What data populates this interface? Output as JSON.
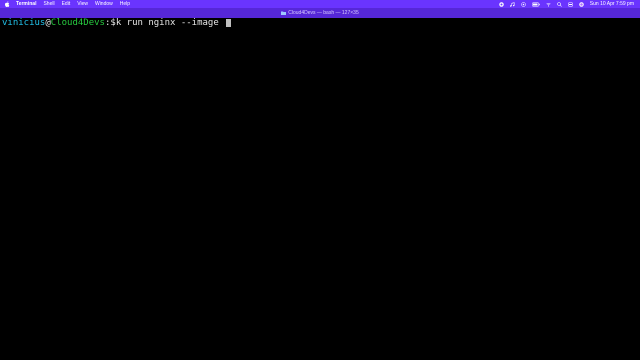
{
  "menubar": {
    "app_name": "Terminal",
    "items": [
      "Shell",
      "Edit",
      "View",
      "Window",
      "Help"
    ],
    "status_icons": [
      "record-icon",
      "music-icon",
      "wifi-status-icon",
      "battery-icon",
      "wifi-icon",
      "search-icon",
      "control-center-icon",
      "siri-icon"
    ],
    "clock": "Sun 10 Apr  7:59 pm"
  },
  "window": {
    "title": "Cloud4Devs — bash — 127×35"
  },
  "terminal": {
    "user": "vinicius",
    "at": "@",
    "host": "Cloud4Devs",
    "separator": ":$",
    "command": "k run nginx --image "
  },
  "colors": {
    "menubar_bg": "#6a34ff",
    "titlebar_bg": "#5627d8",
    "terminal_bg": "#000000",
    "user": "#22c3ec",
    "host": "#27c93f",
    "text": "#e6e6e6"
  }
}
